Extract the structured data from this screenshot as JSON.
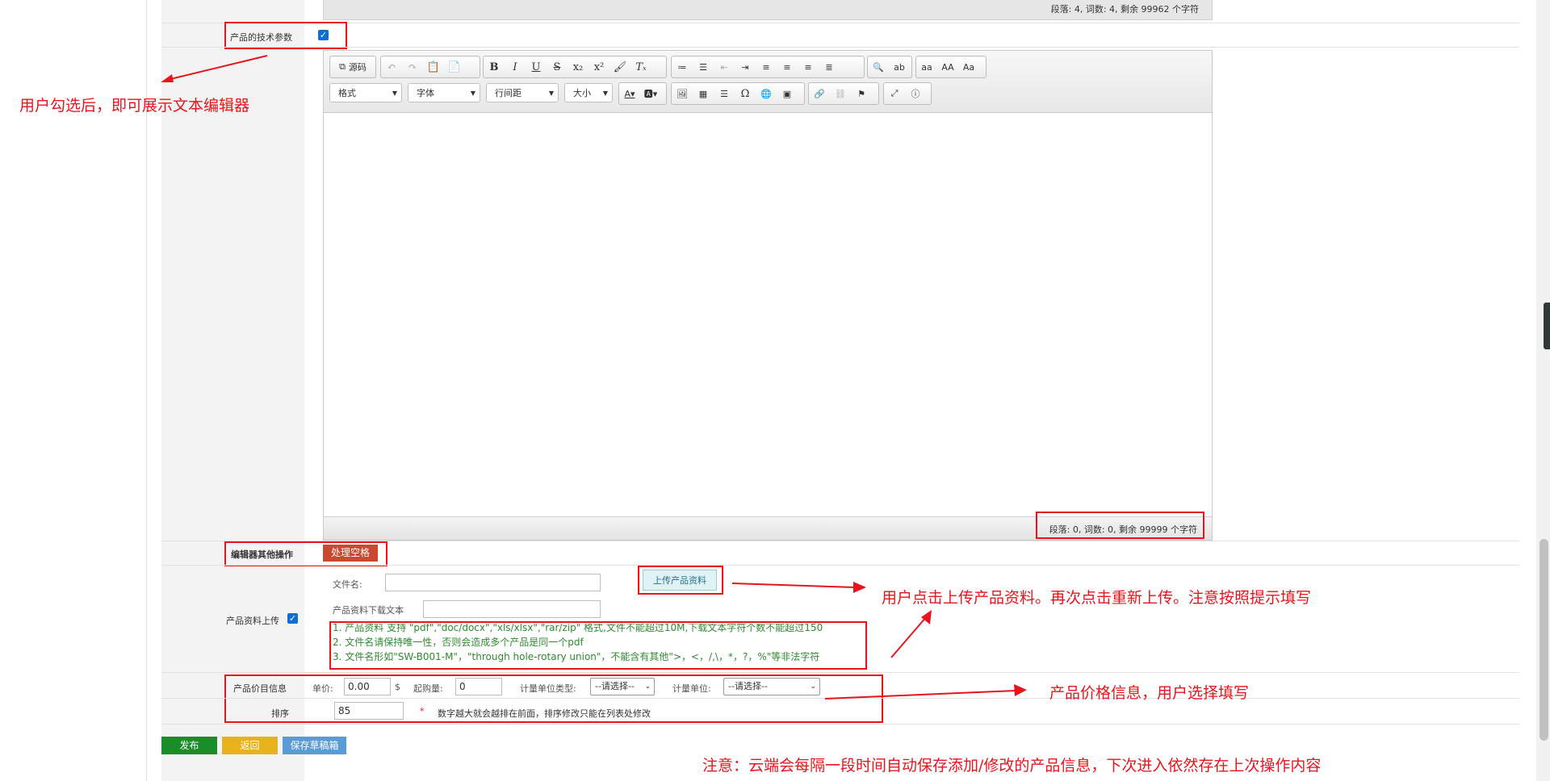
{
  "top_status": "段落: 4, 词数: 4, 剩余 99962 个字符",
  "tech_params": {
    "label": "产品的技术参数",
    "checked": true
  },
  "annotations": {
    "editor": "用户勾选后，即可展示文本编辑器",
    "upload": "用户点击上传产品资料。再次点击重新上传。注意按照提示填写",
    "price": "产品价格信息，用户选择填写",
    "autosave": "注意：云端会每隔一段时间自动保存添加/修改的产品信息，下次进入依然存在上次操作内容"
  },
  "editor": {
    "source_label": "源码",
    "combos": {
      "format": "格式",
      "font": "字体",
      "line_height": "行间距",
      "size": "大小"
    },
    "status": "段落: 0, 词数: 0, 剩余 99999 个字符"
  },
  "editor_ops": {
    "label": "编辑器其他操作",
    "button": "处理空格"
  },
  "upload": {
    "label": "产品资料上传",
    "checked": true,
    "filename_label": "文件名:",
    "filename_value": "",
    "download_text_label": "产品资料下载文本",
    "download_text_value": "",
    "button": "上传产品资料",
    "tips": [
      "1. 产品资料 支持 \"pdf\",\"doc/docx\",\"xls/xlsx\",\"rar/zip\" 格式,文件不能超过10M,下载文本字符个数不能超过150",
      "2. 文件名请保持唯一性，否则会造成多个产品是同一个pdf",
      "3. 文件名形如\"SW-B001-M\"，\"through hole-rotary union\"，不能含有其他\">，<，/,\\，*，?，%\"等非法字符"
    ]
  },
  "price": {
    "label": "产品价目信息",
    "unit_price_label": "单价:",
    "unit_price_value": "0.00",
    "currency": "$",
    "min_qty_label": "起购量:",
    "min_qty_value": "0",
    "unit_type_label": "计量单位类型:",
    "unit_type_value": "--请选择--",
    "unit_label": "计量单位:",
    "unit_value": "--请选择--"
  },
  "sort": {
    "label": "排序",
    "value": "85",
    "required_mark": "*",
    "hint": "数字越大就会越排在前面，排序修改只能在列表处修改"
  },
  "actions": {
    "publish": "发布",
    "back": "返回",
    "save_draft": "保存草稿箱"
  },
  "colors": {
    "annotation_red": "#e8141c",
    "publish": "#1a8c2a",
    "back": "#e8b21a",
    "draft": "#5b9bd5",
    "ops_button": "#c9482e"
  }
}
